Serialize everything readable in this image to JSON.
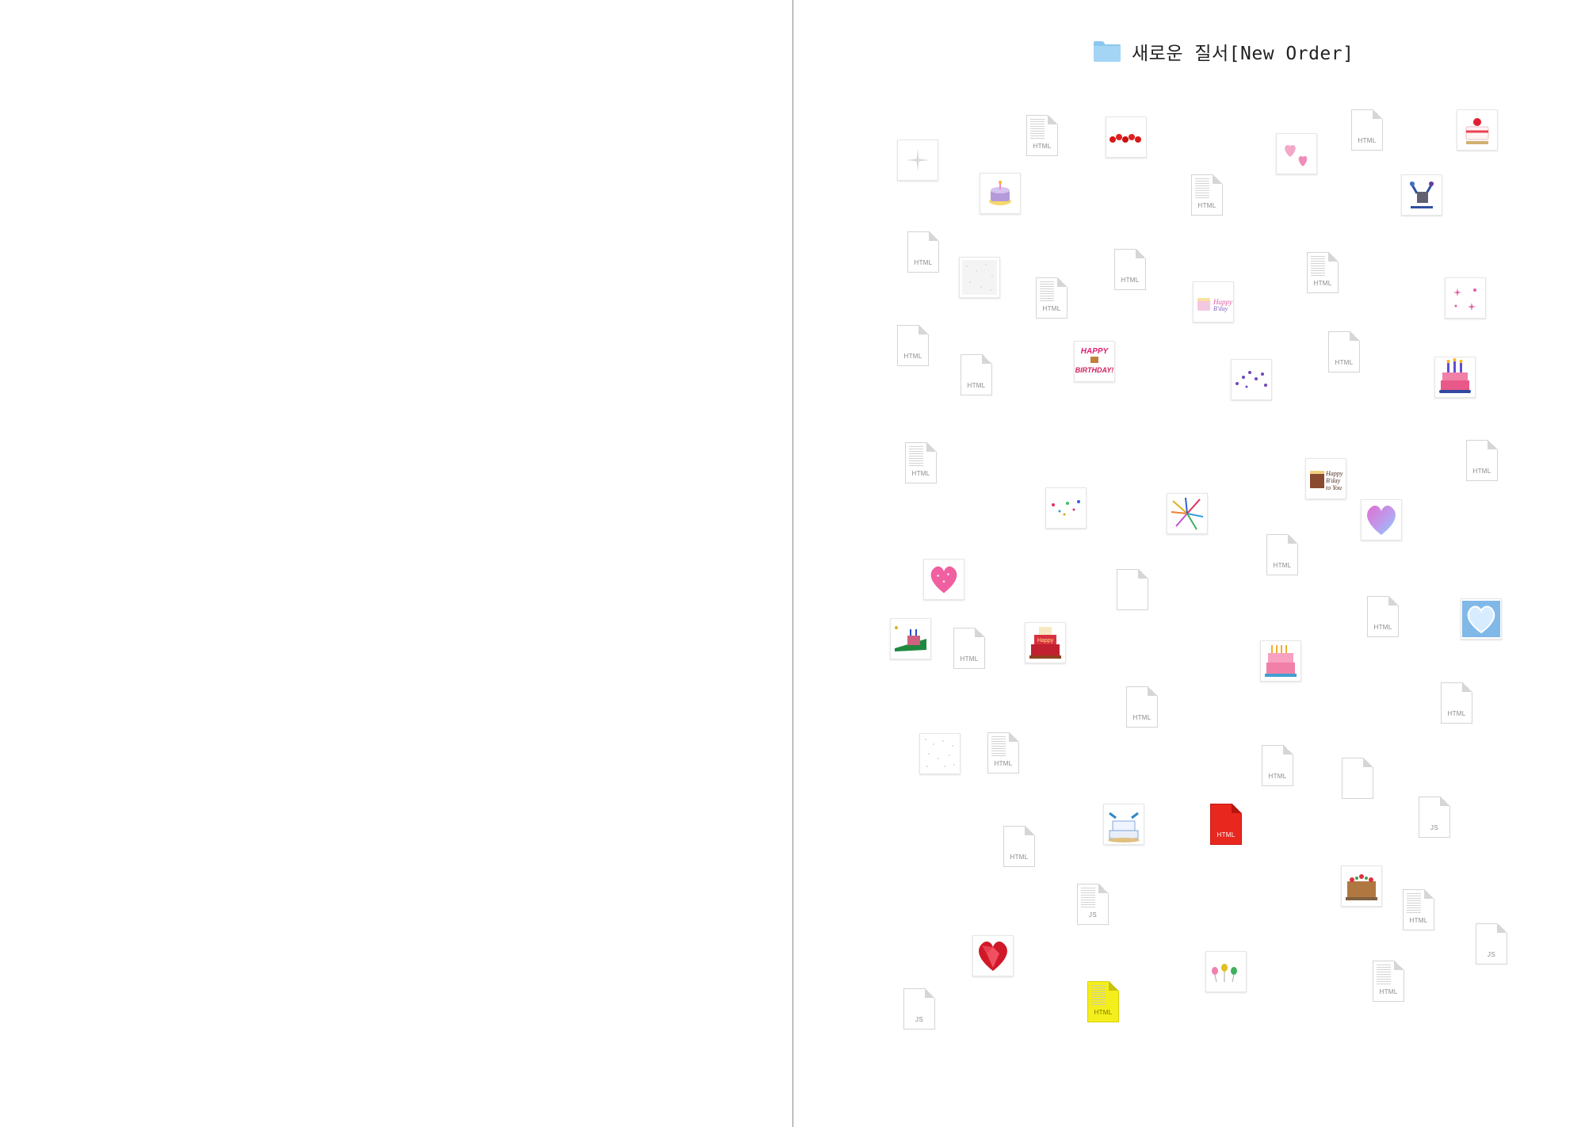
{
  "folder": {
    "name": "새로운 질서[New Order]",
    "icon": "folder-icon",
    "color": "#a4d5f5"
  },
  "files": {
    "html_label": "HTML",
    "js_label": "JS"
  },
  "thumbnails": {
    "icons": [
      "sparkle-icon",
      "birthday-cake-icon",
      "red-beads-icon",
      "pink-hearts-icon",
      "strawberry-cake-icon",
      "champagne-birthday-icon",
      "birthday-cake-text-icon",
      "pink-sparkles-icon",
      "happy-birthday-text-icon",
      "purple-dots-icon",
      "candle-cake-icon",
      "happy-birthday-cake-icon",
      "confetti-dots-icon",
      "confetti-burst-icon",
      "gradient-heart-icon",
      "pink-heart-icon",
      "green-cake-icon",
      "layer-cake-icon",
      "pastel-cake-icon",
      "blue-heart-icon",
      "dotted-pattern-icon",
      "bird-cake-icon",
      "fruit-cake-icon",
      "red-gem-heart-icon",
      "balloons-icon"
    ]
  },
  "colors": {
    "divider": "#8a8a8a",
    "red_file": "#e8271f",
    "yellow_file": "#f4ee1c"
  }
}
